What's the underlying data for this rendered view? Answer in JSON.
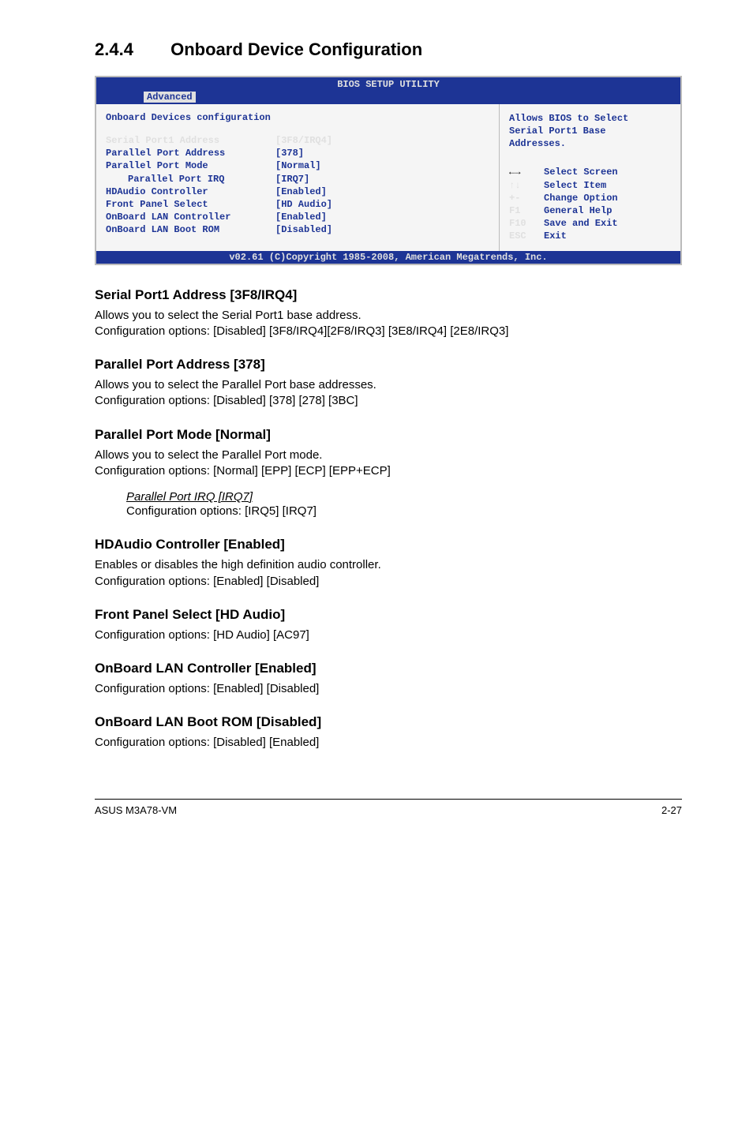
{
  "section": {
    "number": "2.4.4",
    "title": "Onboard Device Configuration"
  },
  "bios": {
    "title": "BIOS SETUP UTILITY",
    "tab": "Advanced",
    "panel_header": "Onboard Devices configuration",
    "items": [
      {
        "label": "Serial Port1 Address",
        "value": "[3F8/IRQ4]",
        "selected": true,
        "indent": false
      },
      {
        "label": "Parallel Port Address",
        "value": "[378]",
        "selected": false,
        "indent": false
      },
      {
        "label": "Parallel Port Mode",
        "value": "[Normal]",
        "selected": false,
        "indent": false
      },
      {
        "label": "Parallel Port IRQ",
        "value": "[IRQ7]",
        "selected": false,
        "indent": true
      },
      {
        "label": "HDAudio Controller",
        "value": "[Enabled]",
        "selected": false,
        "indent": false
      },
      {
        "label": "Front Panel Select",
        "value": "[HD Audio]",
        "selected": false,
        "indent": false
      },
      {
        "label": "OnBoard LAN Controller",
        "value": "[Enabled]",
        "selected": false,
        "indent": false
      },
      {
        "label": "OnBoard LAN Boot ROM",
        "value": "[Disabled]",
        "selected": false,
        "indent": false
      }
    ],
    "help_top": [
      "Allows BIOS to Select",
      "Serial Port1 Base",
      "Addresses."
    ],
    "help_keys": [
      {
        "key": "←→",
        "text": "Select Screen",
        "first": true
      },
      {
        "key": "↑↓",
        "text": "Select Item",
        "first": false
      },
      {
        "key": "+-",
        "text": "Change Option",
        "first": false
      },
      {
        "key": "F1",
        "text": "General Help",
        "first": false
      },
      {
        "key": "F10",
        "text": "Save and Exit",
        "first": false
      },
      {
        "key": "ESC",
        "text": "Exit",
        "first": false
      }
    ],
    "footer": "v02.61 (C)Copyright 1985-2008, American Megatrends, Inc."
  },
  "content": {
    "s1_head": "Serial Port1 Address [3F8/IRQ4]",
    "s1_p1": "Allows you to select the Serial Port1 base address.",
    "s1_p2": "Configuration options: [Disabled] [3F8/IRQ4][2F8/IRQ3] [3E8/IRQ4] [2E8/IRQ3]",
    "s2_head": "Parallel Port Address [378]",
    "s2_p1": "Allows you to select the Parallel Port base addresses.",
    "s2_p2": "Configuration options: [Disabled] [378] [278] [3BC]",
    "s3_head": "Parallel Port Mode [Normal]",
    "s3_p1": "Allows you to select the Parallel Port  mode.",
    "s3_p2": "Configuration options: [Normal] [EPP] [ECP] [EPP+ECP]",
    "s3_sub_head": "Parallel Port IRQ [IRQ7]",
    "s3_sub_p": "Configuration options: [IRQ5] [IRQ7]",
    "s4_head": "HDAudio Controller [Enabled]",
    "s4_p1": "Enables or disables the high definition audio controller.",
    "s4_p2": "Configuration options: [Enabled] [Disabled]",
    "s5_head": "Front Panel Select [HD Audio]",
    "s5_p": "Configuration options: [HD Audio] [AC97]",
    "s6_head": "OnBoard LAN Controller [Enabled]",
    "s6_p": "Configuration options: [Enabled] [Disabled]",
    "s7_head": "OnBoard LAN Boot ROM [Disabled]",
    "s7_p": "Configuration options: [Disabled] [Enabled]"
  },
  "footer": {
    "left": "ASUS M3A78-VM",
    "right": "2-27"
  }
}
